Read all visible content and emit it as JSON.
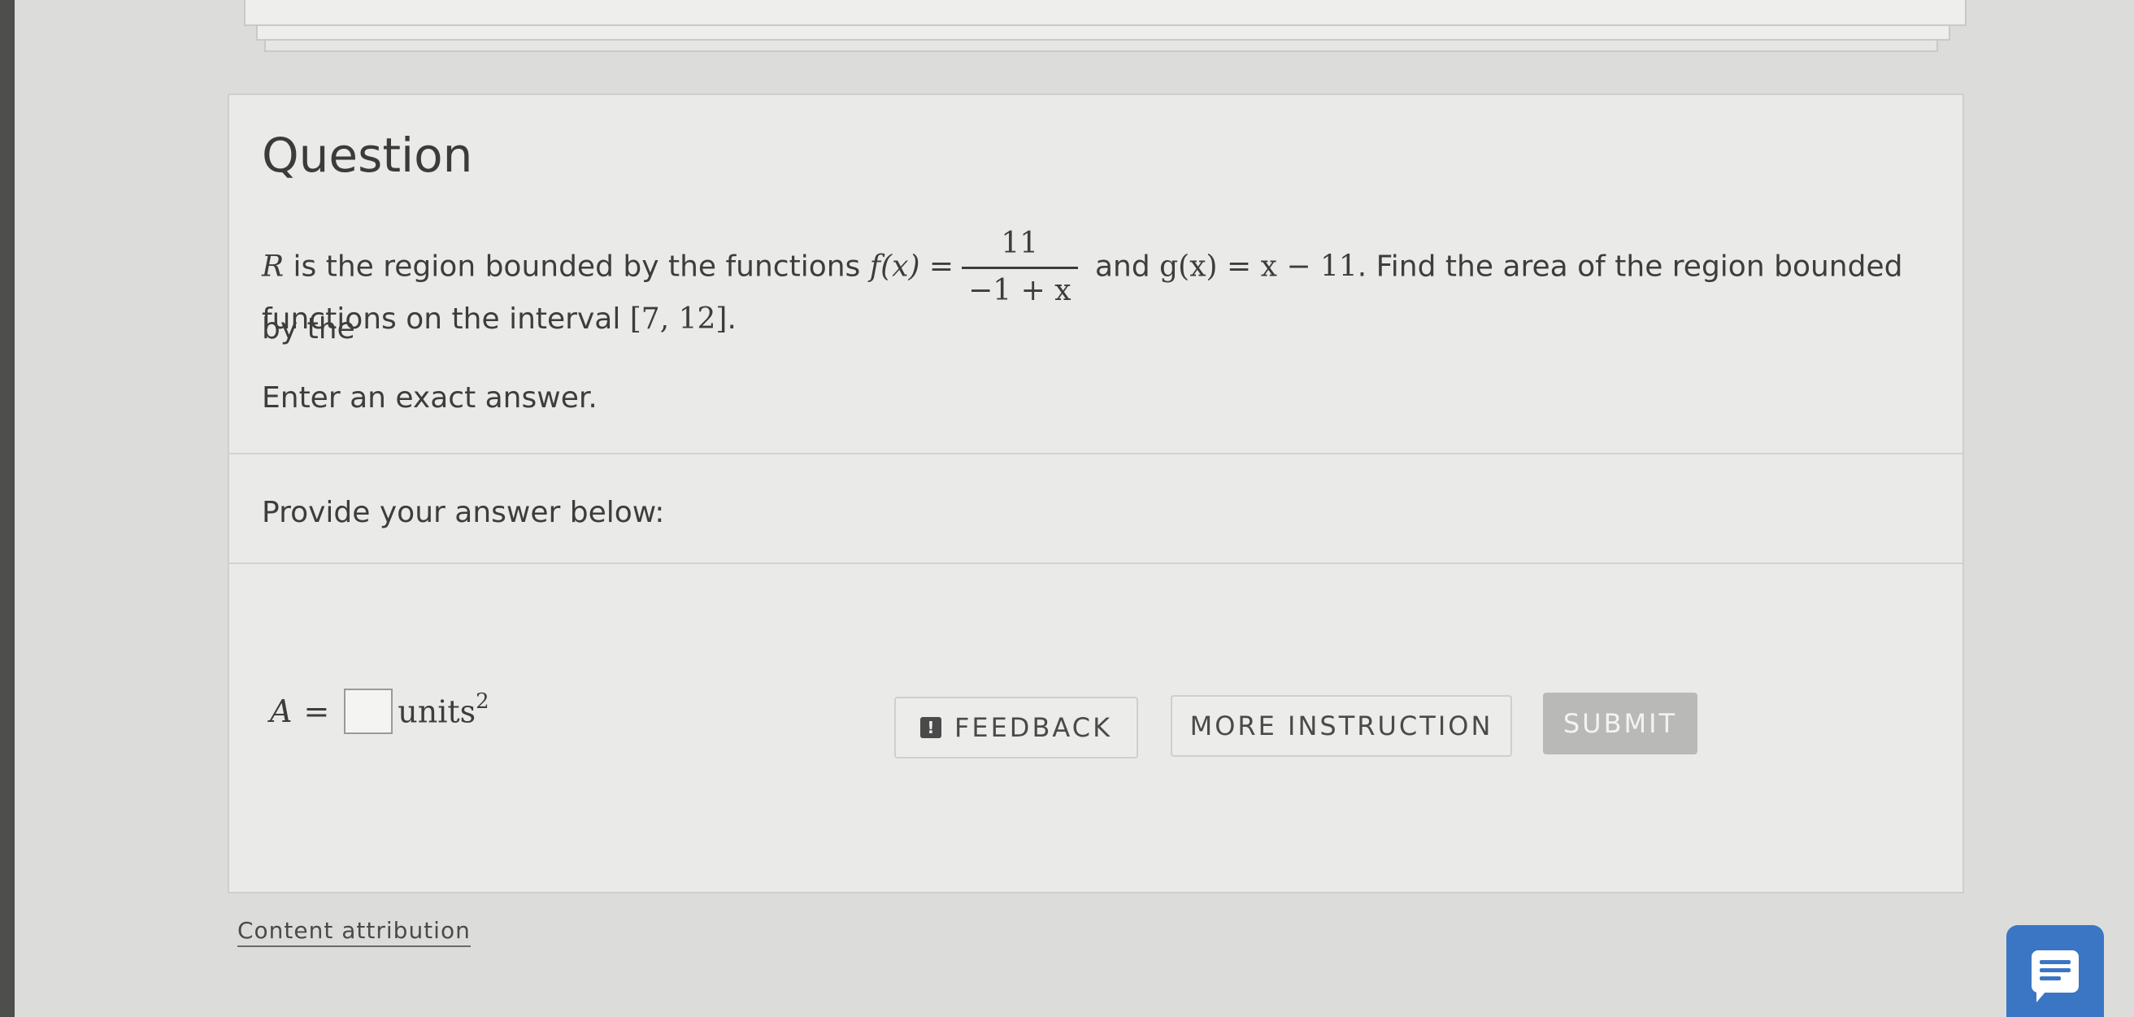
{
  "question": {
    "title": "Question",
    "text_r": "R",
    "text_intro": " is the region bounded by the functions ",
    "f_lhs": "f(x) =",
    "f_num": "11",
    "f_den": "−1 + x",
    "text_and": " and ",
    "g_expr": "g(x) = x − 11",
    "text_find": ". Find the area of the region bounded by the",
    "text_line2": "functions on the interval ",
    "interval": "[7, 12]",
    "period": ".",
    "instruction": "Enter an exact answer."
  },
  "answer": {
    "prompt": "Provide your answer below:",
    "variable": "A",
    "equals": "=",
    "input_value": "",
    "units": "units",
    "units_exp": "2"
  },
  "buttons": {
    "feedback_icon": "!",
    "feedback": "FEEDBACK",
    "more_instruction": "MORE INSTRUCTION",
    "submit": "SUBMIT"
  },
  "footer": {
    "attribution": "Content attribution"
  },
  "icons": {
    "feedback": "feedback-icon",
    "chat": "chat-icon"
  },
  "colors": {
    "submit_disabled": "#b9b9b7",
    "chat_accent": "#3b76c4"
  }
}
